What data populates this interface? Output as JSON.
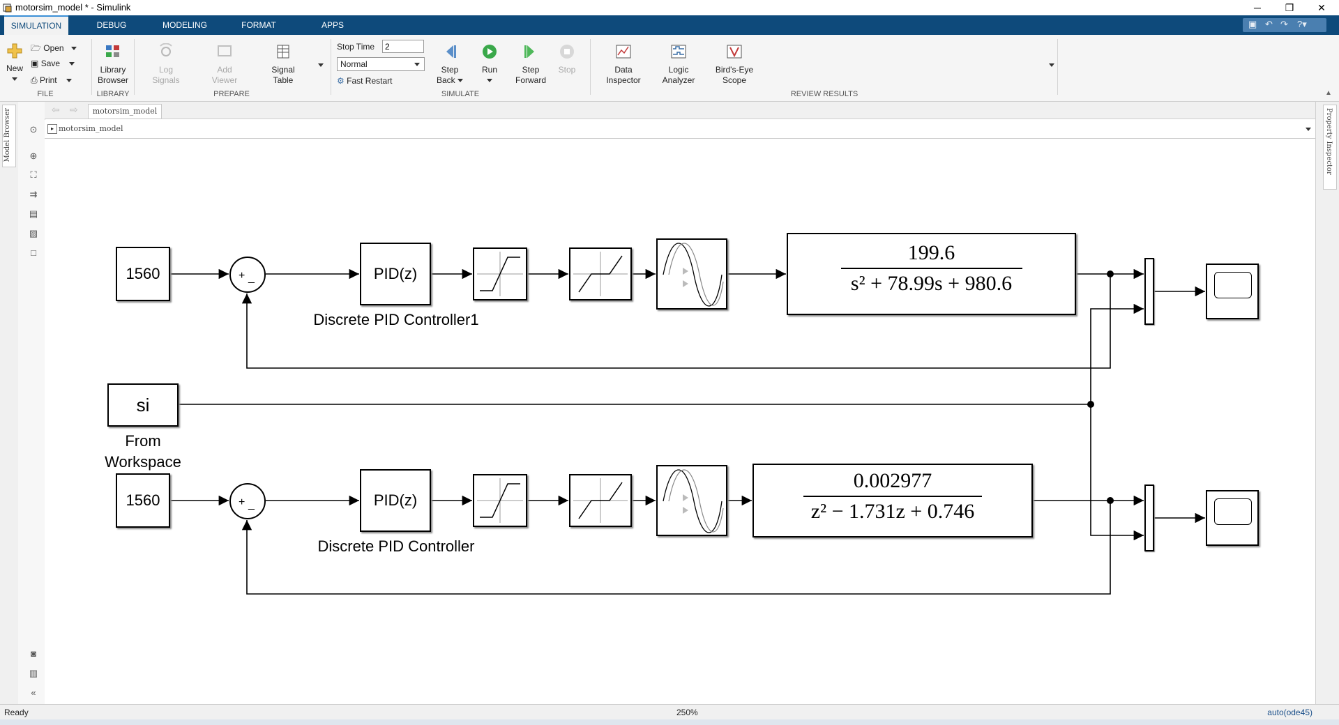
{
  "window": {
    "title": "motorsim_model * - Simulink",
    "minimize": "─",
    "restore": "❐",
    "close": "✕"
  },
  "tabs": [
    "SIMULATION",
    "DEBUG",
    "MODELING",
    "FORMAT",
    "APPS"
  ],
  "ribbon": {
    "file": {
      "label": "FILE",
      "new": "New",
      "open": "Open",
      "save": "Save",
      "print": "Print"
    },
    "library": {
      "label": "LIBRARY",
      "browser_line1": "Library",
      "browser_line2": "Browser"
    },
    "prepare": {
      "label": "PREPARE",
      "log1": "Log",
      "log2": "Signals",
      "viewer1": "Add",
      "viewer2": "Viewer",
      "table1": "Signal",
      "table2": "Table"
    },
    "simulate": {
      "label": "SIMULATE",
      "stop_time_label": "Stop Time",
      "stop_time_value": "2",
      "mode": "Normal",
      "fast_restart": "Fast Restart",
      "step_back1": "Step",
      "step_back2": "Back",
      "run": "Run",
      "step_fwd1": "Step",
      "step_fwd2": "Forward",
      "stop": "Stop"
    },
    "review": {
      "label": "REVIEW RESULTS",
      "data1": "Data",
      "data2": "Inspector",
      "logic1": "Logic",
      "logic2": "Analyzer",
      "birds1": "Bird's-Eye",
      "birds2": "Scope"
    }
  },
  "left_panel": {
    "model_browser": "Model Browser"
  },
  "right_panel": {
    "property_inspector": "Property Inspector"
  },
  "explorer": {
    "crumb": "motorsim_model",
    "path": "motorsim_model"
  },
  "diagram": {
    "top": {
      "constant": "1560",
      "sum_plus": "+",
      "sum_minus": "_",
      "pid": "PID(z)",
      "pid_label": "Discrete PID Controller1",
      "tf_num": "199.6",
      "tf_den": "s² + 78.99s + 980.6"
    },
    "workspace": {
      "value": "si",
      "label_line1": "From",
      "label_line2": "Workspace"
    },
    "bottom": {
      "constant": "1560",
      "sum_plus": "+",
      "sum_minus": "_",
      "pid": "PID(z)",
      "pid_label": "Discrete PID Controller",
      "tf_num": "0.002977",
      "tf_den": "z² − 1.731z + 0.746"
    }
  },
  "status": {
    "left": "Ready",
    "zoom": "250%",
    "solver": "auto(ode45)"
  }
}
